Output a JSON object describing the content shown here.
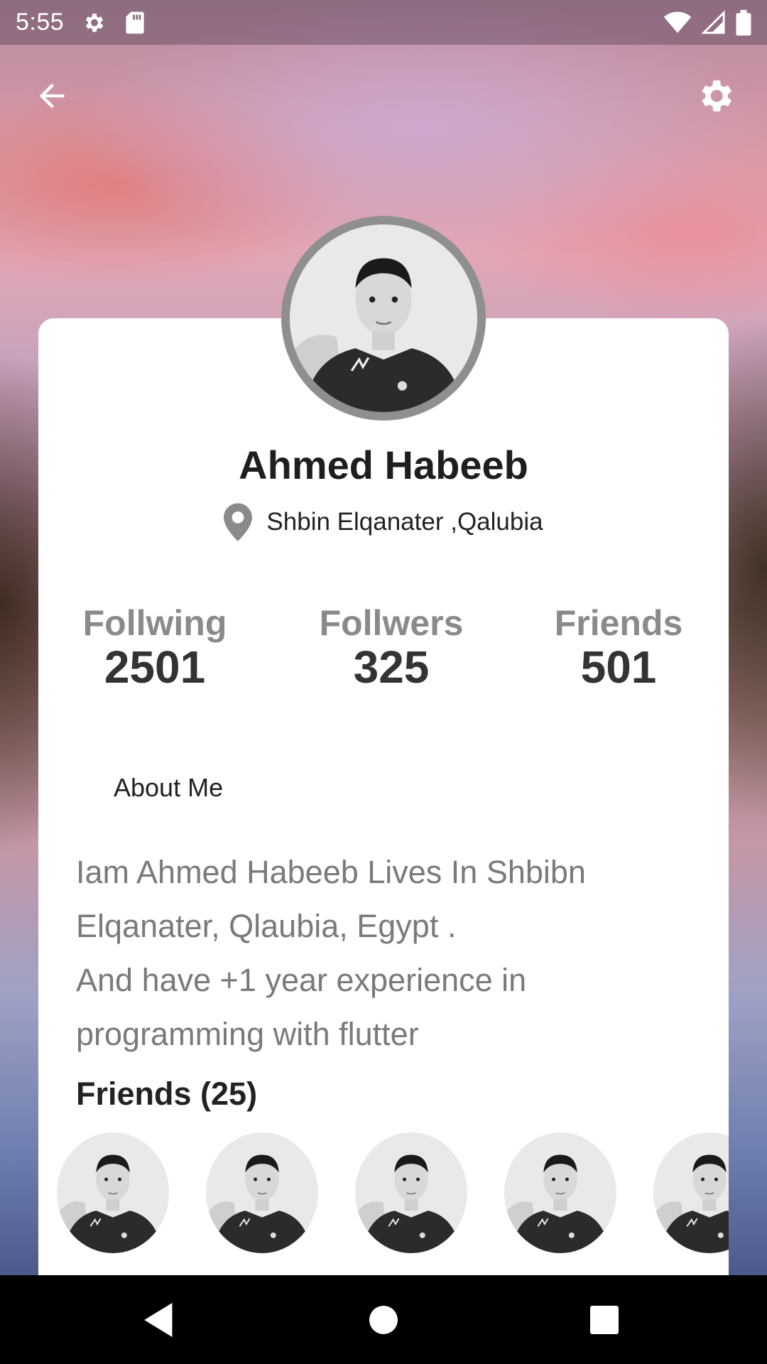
{
  "status_bar": {
    "time": "5:55",
    "icons": [
      "gear-icon",
      "sd-card-icon",
      "wifi-icon",
      "signal-icon",
      "battery-icon"
    ]
  },
  "app_bar": {
    "back_icon": "arrow-back-icon",
    "settings_icon": "settings-gear-icon"
  },
  "profile": {
    "name": "Ahmed Habeeb",
    "location": "Shbin Elqanater ,Qalubia"
  },
  "stats": [
    {
      "label": "Follwing",
      "value": "2501"
    },
    {
      "label": "Follwers",
      "value": "325"
    },
    {
      "label": "Friends",
      "value": "501"
    }
  ],
  "about": {
    "title": "About Me",
    "lines": [
      "Iam Ahmed Habeeb Lives In Shbibn",
      "Elqanater, Qlaubia, Egypt .",
      "And have +1 year experience in",
      "programming with flutter"
    ]
  },
  "friends": {
    "title": "Friends (25)",
    "count_visible": 5
  },
  "colors": {
    "card": "#ffffff",
    "avatar_ring": "#8f8f8f",
    "stat_label": "#8a8a8a",
    "stat_value": "#333333",
    "about_text": "#7a7a7a"
  }
}
